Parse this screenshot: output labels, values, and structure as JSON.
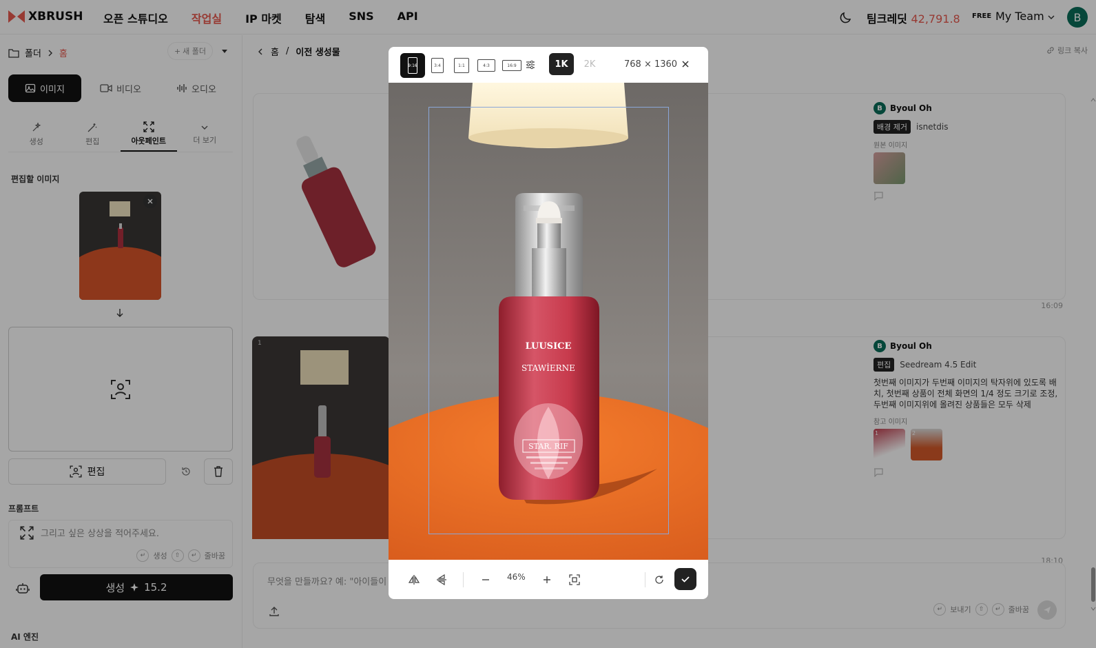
{
  "header": {
    "logo": "XBRUSH",
    "nav": [
      "오픈 스튜디오",
      "작업실",
      "IP 마켓",
      "탐색",
      "SNS",
      "API"
    ],
    "active_nav": "작업실",
    "credit_label": "팀크레딧",
    "credit_value": "42,791.8",
    "plan_badge": "FREE",
    "team_name": "My Team",
    "avatar_initial": "B"
  },
  "left": {
    "folder": "폴더",
    "folder_home": "홈",
    "new_folder": "새 폴더",
    "media_tabs": [
      "이미지",
      "비디오",
      "오디오"
    ],
    "sub_tabs": [
      "생성",
      "편집",
      "아웃페인트",
      "더 보기"
    ],
    "edit_image_label": "편집할 이미지",
    "edit_button": "편집",
    "prompt_label": "프롬프트",
    "prompt_placeholder": "그리고 싶은 상상을 적어주세요.",
    "hint_generate": "생성",
    "hint_newline": "줄바꿈",
    "generate_label": "생성",
    "generate_cost": "15.2",
    "ai_engine_label": "AI 엔진"
  },
  "main": {
    "breadcrumb_home": "홈",
    "breadcrumb_current": "이전 생성물",
    "link_copy": "링크 복사",
    "cards": [
      {
        "user": "Byoul Oh",
        "tag": "배경 제거",
        "model": "isnetdis",
        "source_label": "원본 이미지",
        "time": "16:09"
      },
      {
        "user": "Byoul Oh",
        "tag": "편집",
        "model": "Seedream 4.5 Edit",
        "description": "첫번째 이미지가 두번째 이미지의 탁자위에 있도록 배치, 첫번째 상품이 전체 화면의 1/4 정도 크기로 조정, 두번째 이미지위에 올려진 상품들은 모두 삭제",
        "ref_label": "참고 이미지",
        "ref_nums": [
          "1",
          "2"
        ],
        "card_index": "1",
        "time": "18:10"
      }
    ],
    "composer_placeholder": "무엇을 만들까요? 예: \"아이들이",
    "hint_send": "보내기",
    "hint_newline": "줄바꿈"
  },
  "modal": {
    "ratios": [
      "9:16",
      "3:4",
      "1:1",
      "4:3",
      "16:9"
    ],
    "active_ratio": "9:16",
    "resolutions": [
      "1K",
      "2K"
    ],
    "active_resolution": "1K",
    "dimensions": "768 × 1360",
    "zoom": "46%",
    "product_text": [
      "LUUSICE",
      "STAWİERNE",
      "STAR. RIF"
    ]
  }
}
